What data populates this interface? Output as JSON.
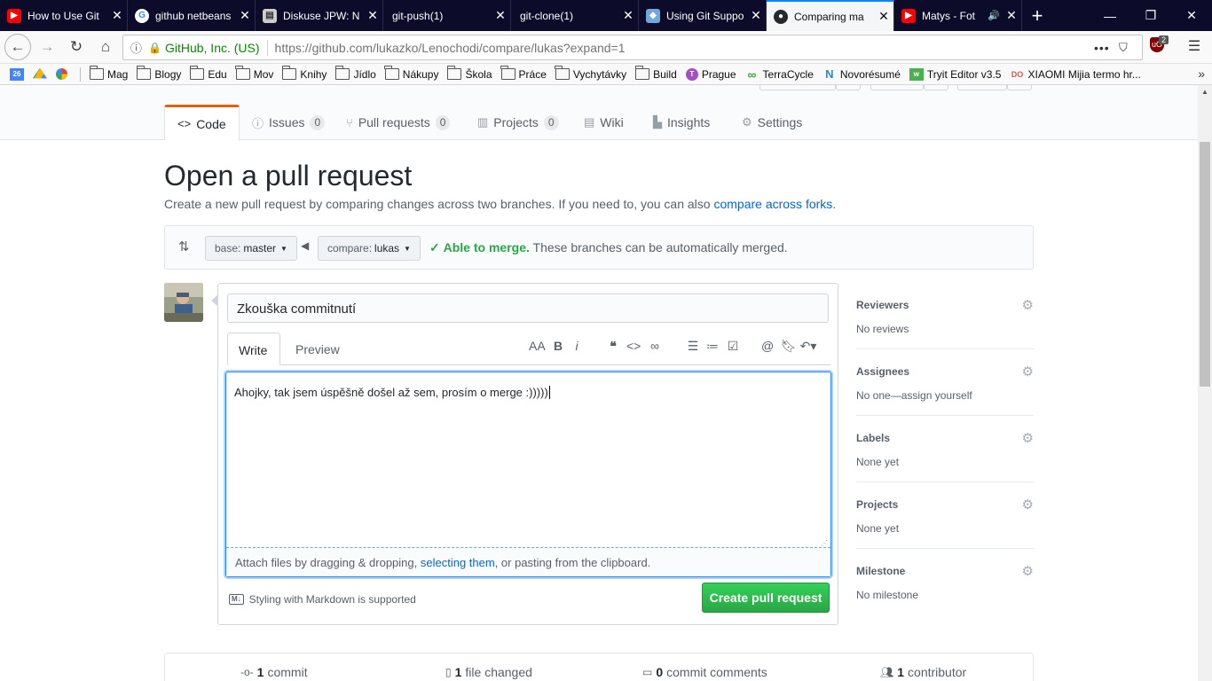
{
  "browser": {
    "tabs": [
      {
        "title": "How to Use Git",
        "favicon": "youtube-icon",
        "active": false
      },
      {
        "title": "github netbeans",
        "favicon": "google-icon",
        "active": false
      },
      {
        "title": "Diskuse JPW: N",
        "favicon": "document-icon",
        "active": false
      },
      {
        "title": "git-push(1)",
        "favicon": "",
        "active": false
      },
      {
        "title": "git-clone(1)",
        "favicon": "",
        "active": false
      },
      {
        "title": "Using Git Suppo",
        "favicon": "cube-icon",
        "active": false
      },
      {
        "title": "Comparing ma",
        "favicon": "github-icon",
        "active": true
      },
      {
        "title": "Matys - Fot",
        "favicon": "youtube-icon",
        "active": false
      }
    ],
    "url_org": "GitHub, Inc. (US)",
    "url": "https://github.com/lukazko/Lenochodi/compare/lukas?expand=1",
    "ext_badge": "2",
    "bookmarks": [
      {
        "label": "",
        "icon": "calendar-icon",
        "text": "26"
      },
      {
        "label": "",
        "icon": "drive-icon"
      },
      {
        "label": "",
        "icon": "photos-icon"
      },
      {
        "label": "Mag",
        "icon": "folder-icon"
      },
      {
        "label": "Blogy",
        "icon": "folder-icon"
      },
      {
        "label": "Edu",
        "icon": "folder-icon"
      },
      {
        "label": "Mov",
        "icon": "folder-icon"
      },
      {
        "label": "Knihy",
        "icon": "folder-icon"
      },
      {
        "label": "Jídlo",
        "icon": "folder-icon"
      },
      {
        "label": "Nákupy",
        "icon": "folder-icon"
      },
      {
        "label": "Škola",
        "icon": "folder-icon"
      },
      {
        "label": "Práce",
        "icon": "folder-icon"
      },
      {
        "label": "Vychytávky",
        "icon": "folder-icon"
      },
      {
        "label": "Build",
        "icon": "folder-icon"
      },
      {
        "label": "Prague",
        "icon": "prague-icon"
      },
      {
        "label": "TerraCycle",
        "icon": "terracycle-icon"
      },
      {
        "label": "Novorésumé",
        "icon": "novoresume-icon"
      },
      {
        "label": "Tryit Editor v3.5",
        "icon": "w3schools-icon"
      },
      {
        "label": "XIAOMI Mijia termo hr...",
        "icon": "do-icon"
      }
    ]
  },
  "repo_nav": {
    "tabs": [
      {
        "label": "Code",
        "count": null
      },
      {
        "label": "Issues",
        "count": "0"
      },
      {
        "label": "Pull requests",
        "count": "0"
      },
      {
        "label": "Projects",
        "count": "0"
      },
      {
        "label": "Wiki",
        "count": null
      },
      {
        "label": "Insights",
        "count": null
      },
      {
        "label": "Settings",
        "count": null
      }
    ]
  },
  "main": {
    "title": "Open a pull request",
    "subtitle": "Create a new pull request by comparing changes across two branches. If you need to, you can also",
    "subtitle_link": "compare across forks",
    "base_label": "base:",
    "base_branch": "master",
    "compare_label": "compare:",
    "compare_branch": "lukas",
    "merge_ok": "Able to merge.",
    "merge_text": "These branches can be automatically merged."
  },
  "form": {
    "title_value": "Zkouška commitnutí",
    "tab_write": "Write",
    "tab_preview": "Preview",
    "body": "Ahojky, tak jsem úspěšně došel až sem, prosím o merge :)))))",
    "attach_pre": "Attach files by dragging & dropping,",
    "attach_link": "selecting them",
    "attach_post": ", or pasting from the clipboard.",
    "markdown_badge": "M↓",
    "markdown_note": "Styling with Markdown is supported",
    "submit": "Create pull request",
    "toolbar": [
      "AA",
      "B",
      "i"
    ]
  },
  "sidebar": [
    {
      "label": "Reviewers",
      "value": "No reviews"
    },
    {
      "label": "Assignees",
      "value": "No one—assign yourself"
    },
    {
      "label": "Labels",
      "value": "None yet"
    },
    {
      "label": "Projects",
      "value": "None yet"
    },
    {
      "label": "Milestone",
      "value": "No milestone"
    }
  ],
  "stats": [
    {
      "num": "1",
      "label": "commit"
    },
    {
      "num": "1",
      "label": "file changed"
    },
    {
      "num": "0",
      "label": "commit comments"
    },
    {
      "num": "1",
      "label": "contributor"
    }
  ],
  "colors": {
    "accent": "#0366d6",
    "success": "#28a745",
    "tab_accent": "#e36209"
  }
}
